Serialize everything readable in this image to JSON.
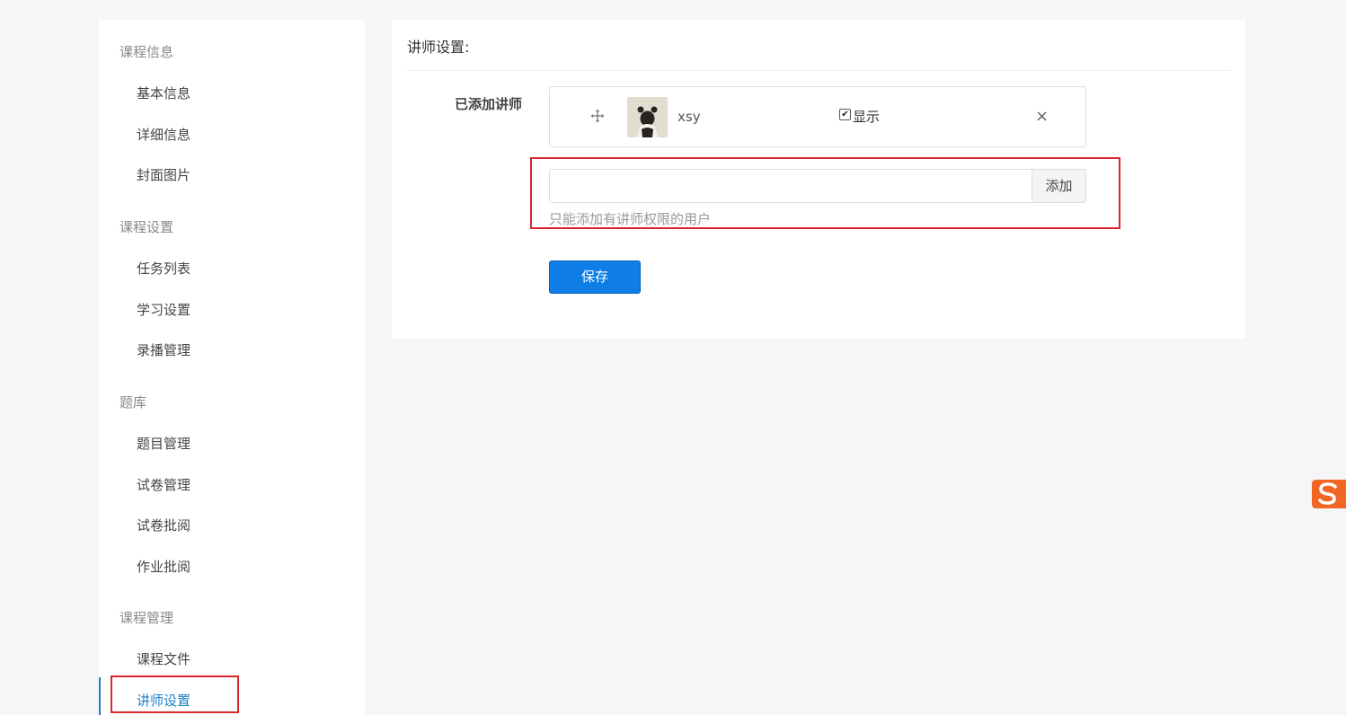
{
  "sidebar": {
    "groups": [
      {
        "title": "课程信息",
        "items": [
          "基本信息",
          "详细信息",
          "封面图片"
        ]
      },
      {
        "title": "课程设置",
        "items": [
          "任务列表",
          "学习设置",
          "录播管理"
        ]
      },
      {
        "title": "题库",
        "items": [
          "题目管理",
          "试卷管理",
          "试卷批阅",
          "作业批阅"
        ]
      },
      {
        "title": "课程管理",
        "items": [
          "课程文件",
          "讲师设置"
        ]
      }
    ],
    "active_item": "讲师设置"
  },
  "main": {
    "title": "讲师设置:",
    "added_label": "已添加讲师",
    "teacher": {
      "name": "xsy",
      "show_label": "显示",
      "show_checked": true
    },
    "add_input_value": "",
    "add_button": "添加",
    "help_text": "只能添加有讲师权限的用户",
    "save_button": "保存"
  },
  "colors": {
    "accent": "#1f7fc8",
    "primary_button": "#0e7ee6",
    "highlight_box": "#d9262c",
    "background": "#f5f6f8"
  }
}
